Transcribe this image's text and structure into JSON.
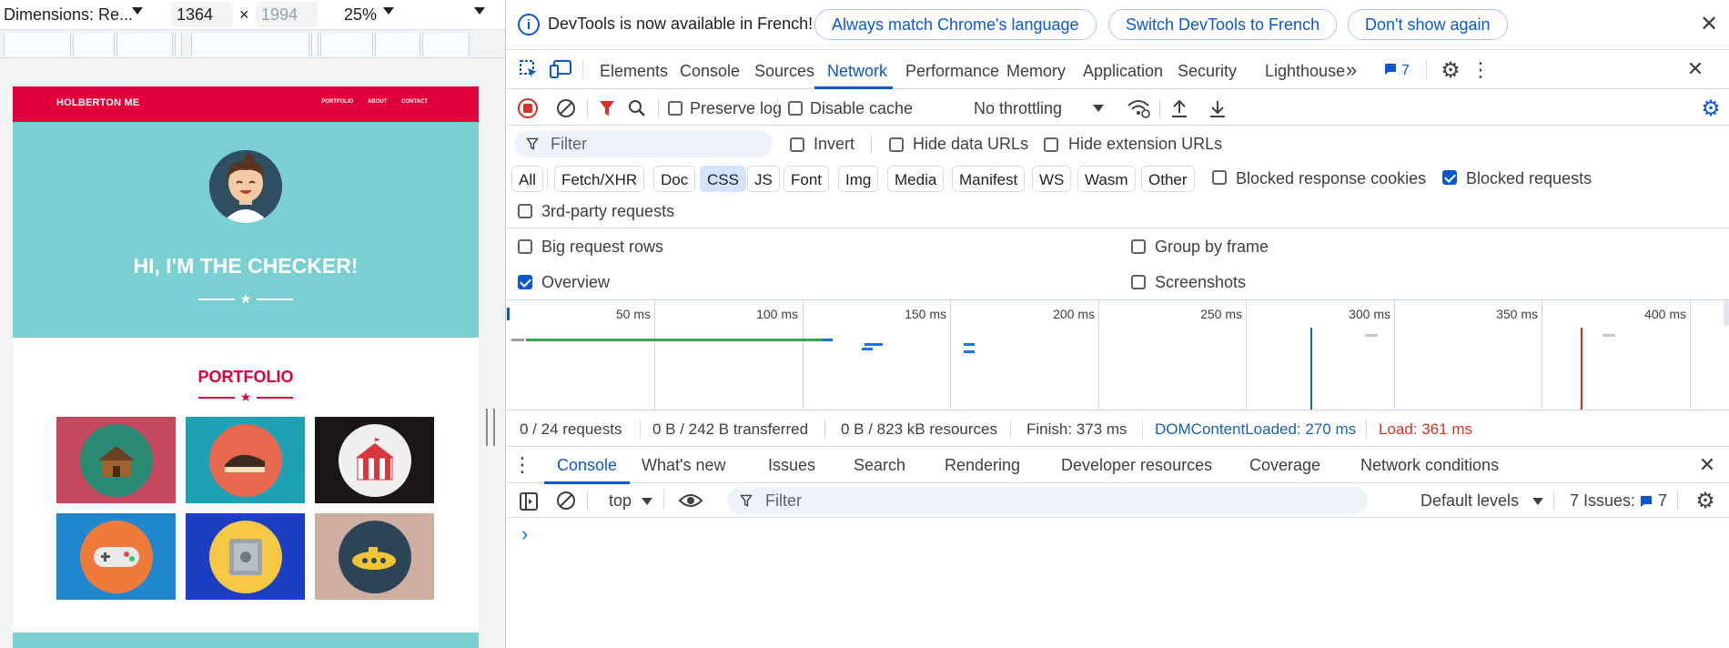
{
  "device_toolbar": {
    "dimensions_label": "Dimensions: Re...",
    "width_value": "1364",
    "height_placeholder": "1994",
    "times": "×",
    "zoom": "25%"
  },
  "site": {
    "brand": "HOLBERTON ME",
    "nav_links": [
      "PORTFOLIO",
      "ABOUT",
      "CONTACT"
    ],
    "hero_title": "HI, I'M THE CHECKER!",
    "section_title": "PORTFOLIO",
    "tiles": [
      {
        "name": "cabin",
        "bg": "#c5485f",
        "disc": "#2a8a74",
        "glyph": "🏠"
      },
      {
        "name": "cake",
        "bg": "#1fa1b5",
        "disc": "#e8684f",
        "glyph": "🍰"
      },
      {
        "name": "circus",
        "bg": "#1a1618",
        "disc": "#f0f0f0",
        "glyph": "🎪"
      },
      {
        "name": "game-controller",
        "bg": "#2087cf",
        "disc": "#ee7b3a",
        "glyph": "🎮"
      },
      {
        "name": "safe",
        "bg": "#1c3ec2",
        "disc": "#f4c842",
        "glyph": "🔒"
      },
      {
        "name": "submarine",
        "bg": "#cdaea0",
        "disc": "#2d4556",
        "glyph": "🚤"
      }
    ],
    "colors": {
      "brand_red": "#e2003b",
      "hero_teal": "#79cfd2"
    }
  },
  "infobar": {
    "message": "DevTools is now available in French!",
    "btn_match": "Always match Chrome's language",
    "btn_switch": "Switch DevTools to French",
    "btn_dismiss": "Don't show again"
  },
  "main_tabs": [
    "Elements",
    "Console",
    "Sources",
    "Network",
    "Performance",
    "Memory",
    "Application",
    "Security",
    "Lighthouse"
  ],
  "active_main_tab": "Network",
  "issues_badge": "7",
  "network_toolbar": {
    "preserve_log": "Preserve log",
    "disable_cache": "Disable cache",
    "throttling": "No throttling"
  },
  "filter_row": {
    "placeholder": "Filter",
    "invert": "Invert",
    "hide_data_urls": "Hide data URLs",
    "hide_extension_urls": "Hide extension URLs"
  },
  "type_chips": [
    "All",
    "Fetch/XHR",
    "Doc",
    "CSS",
    "JS",
    "Font",
    "Img",
    "Media",
    "Manifest",
    "WS",
    "Wasm",
    "Other"
  ],
  "selected_chip": "CSS",
  "blocked_response_cookies": "Blocked response cookies",
  "blocked_requests": "Blocked requests",
  "third_party": "3rd-party requests",
  "settings_options": {
    "big_request_rows": "Big request rows",
    "group_by_frame": "Group by frame",
    "overview": "Overview",
    "screenshots": "Screenshots"
  },
  "timeline_ticks": [
    "50 ms",
    "100 ms",
    "150 ms",
    "200 ms",
    "250 ms",
    "300 ms",
    "350 ms",
    "400 ms"
  ],
  "status_bar": {
    "requests": "0 / 24 requests",
    "transferred": "0 B / 242 B transferred",
    "resources": "0 B / 823 kB resources",
    "finish": "Finish: 373 ms",
    "dom_content_loaded": "DOMContentLoaded: 270 ms",
    "load": "Load: 361 ms",
    "dcl_color": "#1a5fb4",
    "load_color": "#d93025"
  },
  "drawer_tabs": [
    "Console",
    "What's new",
    "Issues",
    "Search",
    "Rendering",
    "Developer resources",
    "Coverage",
    "Network conditions"
  ],
  "active_drawer_tab": "Console",
  "console_toolbar": {
    "context": "top",
    "filter_placeholder": "Filter",
    "levels": "Default levels",
    "issues_label": "7 Issues:",
    "issues_count": "7"
  },
  "prompt_glyph": "›"
}
